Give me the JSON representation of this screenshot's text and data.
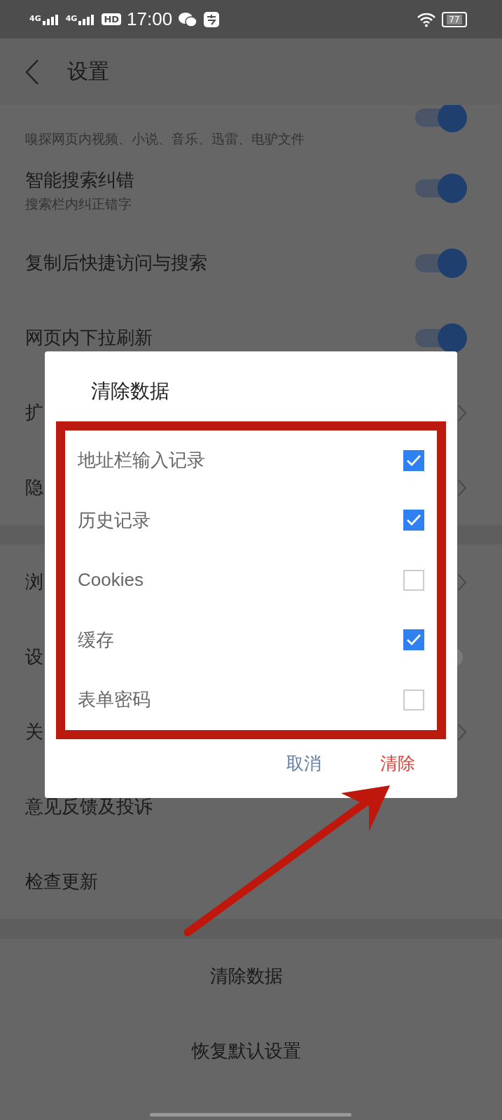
{
  "status_bar": {
    "network_1": "4G",
    "network_2": "4G",
    "hd_badge": "HD",
    "time": "17:00",
    "battery": "77"
  },
  "header": {
    "title": "设置"
  },
  "settings": [
    {
      "kind": "toggle",
      "subtitle": "嗅探网页内视频、小说、音乐、迅雷、电驴文件",
      "on": true
    },
    {
      "kind": "toggle",
      "title": "智能搜索纠错",
      "subtitle": "搜索栏内纠正错字",
      "on": true
    },
    {
      "kind": "toggle",
      "title": "复制后快捷访问与搜索",
      "on": true
    },
    {
      "kind": "toggle",
      "title": "网页内下拉刷新",
      "on": true
    },
    {
      "kind": "link",
      "title": "扩"
    },
    {
      "kind": "link",
      "title": "隐"
    },
    {
      "kind": "gap"
    },
    {
      "kind": "link",
      "title": "浏"
    },
    {
      "kind": "toggle",
      "title": "设",
      "on": false
    },
    {
      "kind": "link",
      "title": "关"
    },
    {
      "kind": "plain",
      "title": "意见反馈及投诉"
    },
    {
      "kind": "plain",
      "title": "检查更新"
    },
    {
      "kind": "gap"
    },
    {
      "kind": "action",
      "title": "清除数据"
    },
    {
      "kind": "action",
      "title": "恢复默认设置"
    }
  ],
  "dialog": {
    "title": "清除数据",
    "options": [
      {
        "label": "地址栏输入记录",
        "checked": true
      },
      {
        "label": "历史记录",
        "checked": true
      },
      {
        "label": "Cookies",
        "checked": false
      },
      {
        "label": "缓存",
        "checked": true
      },
      {
        "label": "表单密码",
        "checked": false
      }
    ],
    "buttons": [
      {
        "label": "取消",
        "kind": "cancel"
      },
      {
        "label": "清除",
        "kind": "confirm"
      }
    ]
  }
}
